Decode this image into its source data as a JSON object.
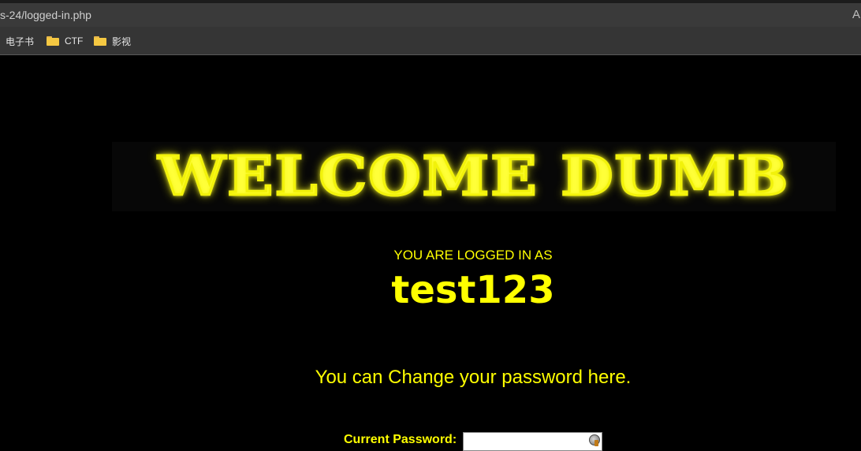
{
  "browser": {
    "url": "s-24/logged-in.php",
    "reader_glyph": "A",
    "bookmarks": [
      {
        "label": "电子书",
        "icon": "none"
      },
      {
        "label": "CTF",
        "icon": "folder-icon"
      },
      {
        "label": "影视",
        "icon": "folder-icon"
      }
    ]
  },
  "page": {
    "banner_text": "WELCOME DUMB",
    "logged_in_label": "YOU ARE LOGGED IN AS",
    "username": "test123",
    "change_message": "You can Change your password here.",
    "current_password_label": "Current Password:",
    "current_password_value": ""
  },
  "colors": {
    "background": "#000000",
    "text_accent": "#ffff00",
    "banner_glow": "#f2f20a",
    "banner_metal": "#8a8a8a"
  }
}
